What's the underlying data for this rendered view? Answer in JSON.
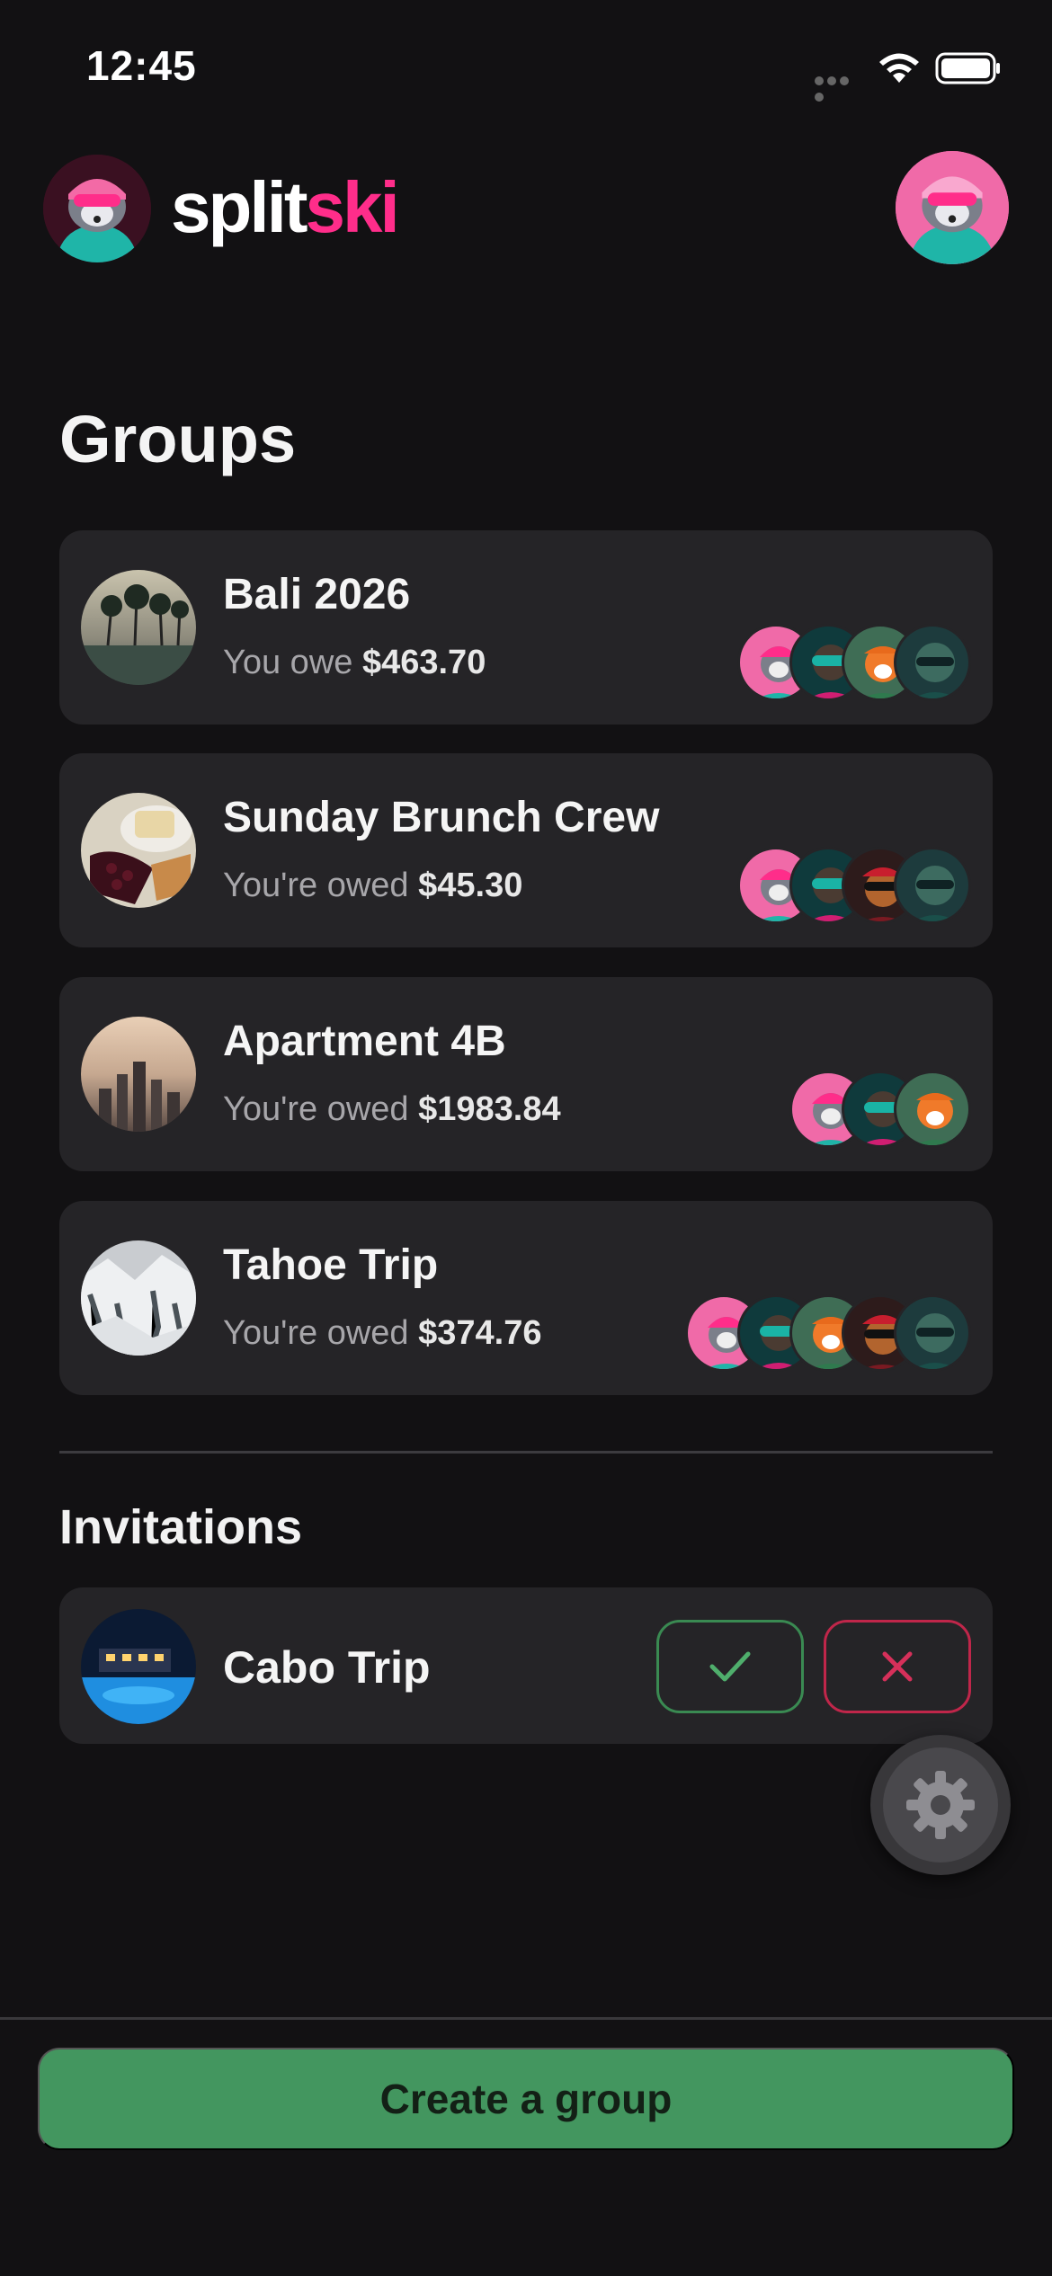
{
  "status_bar": {
    "time": "12:45"
  },
  "header": {
    "brand_part1": "split",
    "brand_part2": "ski",
    "brand_color": "#ff2d8a"
  },
  "page_title": "Groups",
  "groups": [
    {
      "name": "Bali 2026",
      "balance_label": "You owe",
      "amount": "$463.70",
      "member_count": 4
    },
    {
      "name": "Sunday Brunch Crew",
      "balance_label": "You're owed",
      "amount": "$45.30",
      "member_count": 4
    },
    {
      "name": "Apartment 4B",
      "balance_label": "You're owed",
      "amount": "$1983.84",
      "member_count": 3
    },
    {
      "name": "Tahoe Trip",
      "balance_label": "You're owed",
      "amount": "$374.76",
      "member_count": 5
    }
  ],
  "invitations": {
    "title": "Invitations",
    "items": [
      {
        "name": "Cabo Trip"
      }
    ]
  },
  "icons": {
    "accept": "check-icon",
    "decline": "close-icon",
    "settings": "gear-icon",
    "wifi": "wifi-icon",
    "battery": "battery-icon"
  },
  "colors": {
    "accept": "#3a8a52",
    "decline": "#c0264a",
    "primary_button": "#43965f",
    "background": "#121113",
    "card": "#252427"
  },
  "footer": {
    "create_label": "Create a group"
  }
}
